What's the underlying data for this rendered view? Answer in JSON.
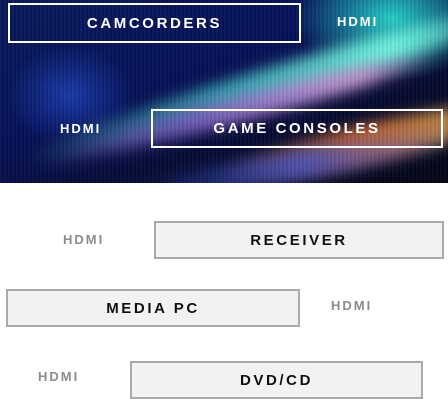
{
  "hero": {
    "camcorders_label": "CAMCORDERS",
    "camcorders_port": "HDMI",
    "game_consoles_port": "HDMI",
    "game_consoles_label": "GAME CONSOLES"
  },
  "devices": {
    "receiver": {
      "port": "HDMI",
      "label": "RECEIVER"
    },
    "media_pc": {
      "label": "MEDIA PC",
      "port": "HDMI"
    },
    "dvd_cd": {
      "port": "HDMI",
      "label": "DVD/CD"
    }
  },
  "colors": {
    "hero_text": "#ffffff",
    "light_button_border": "#aaaaaa",
    "light_button_bg": "#f2f2f2",
    "port_label_gray": "#8c8c8c"
  }
}
